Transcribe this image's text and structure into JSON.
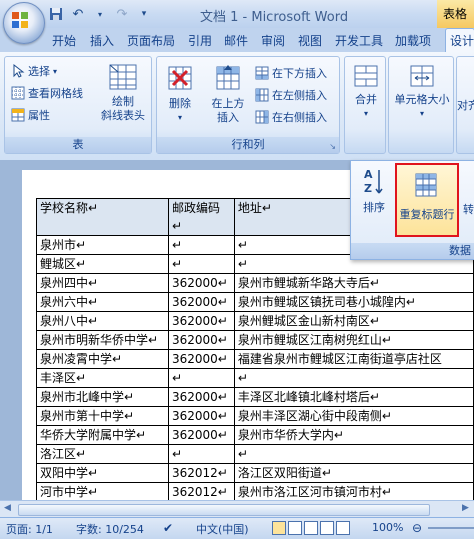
{
  "window": {
    "title": "文档 1 - Microsoft Word",
    "table_tools_label": "表格"
  },
  "tabs": [
    "开始",
    "插入",
    "页面布局",
    "引用",
    "邮件",
    "审阅",
    "视图",
    "开发工具",
    "加载项",
    "设计"
  ],
  "ribbon": {
    "table_group": {
      "label": "表",
      "select": "选择",
      "view_gridlines": "查看网格线",
      "properties": "属性",
      "draw_diagonal_line1": "绘制",
      "draw_diagonal_line2": "斜线表头"
    },
    "rows_cols_group": {
      "label": "行和列",
      "delete": "删除",
      "insert_above1": "在上方",
      "insert_above2": "插入",
      "insert_below": "在下方插入",
      "insert_left": "在左侧插入",
      "insert_right": "在右侧插入"
    },
    "merge": "合并",
    "cell_size": "单元格大小",
    "align": "对齐",
    "data_popup": {
      "sort": "排序",
      "repeat_header": "重复标题行",
      "convert": "转",
      "label": "数据"
    }
  },
  "table": {
    "header": [
      "学校名称↵",
      "邮政编码↵",
      "地址↵"
    ],
    "rows": [
      [
        "泉州市↵",
        "↵",
        "↵"
      ],
      [
        "鲤城区↵",
        "↵",
        "↵"
      ],
      [
        "泉州四中↵",
        "362000↵",
        "泉州市鲤城新华路大寺后↵"
      ],
      [
        "泉州六中↵",
        "362000↵",
        "泉州市鲤城区镇抚司巷小城隍内↵"
      ],
      [
        "泉州八中↵",
        "362000↵",
        "泉州鲤城区金山新村南区↵"
      ],
      [
        "泉州市明新华侨中学↵",
        "362000↵",
        "泉州市鲤城区江南树兜红山↵"
      ],
      [
        "泉州凌霄中学↵",
        "362000↵",
        "福建省泉州市鲤城区江南街道亭店社区"
      ],
      [
        "丰泽区↵",
        "↵",
        "↵"
      ],
      [
        "泉州市北峰中学↵",
        "362000↵",
        "丰泽区北峰镇北峰村塔后↵"
      ],
      [
        "泉州市第十中学↵",
        "362000↵",
        "泉州丰泽区湖心街中段南侧↵"
      ],
      [
        "华侨大学附属中学↵",
        "362000↵",
        "泉州市华侨大学内↵"
      ],
      [
        "洛江区↵",
        "↵",
        "↵"
      ],
      [
        "双阳中学↵",
        "362012↵",
        "洛江区双阳街道↵"
      ],
      [
        "河市中学↵",
        "362012↵",
        "泉州市洛江区河市镇河市村↵"
      ]
    ]
  },
  "status": {
    "page": "页面: 1/1",
    "words": "字数: 10/254",
    "language": "中文(中国)",
    "zoom": "100%"
  }
}
